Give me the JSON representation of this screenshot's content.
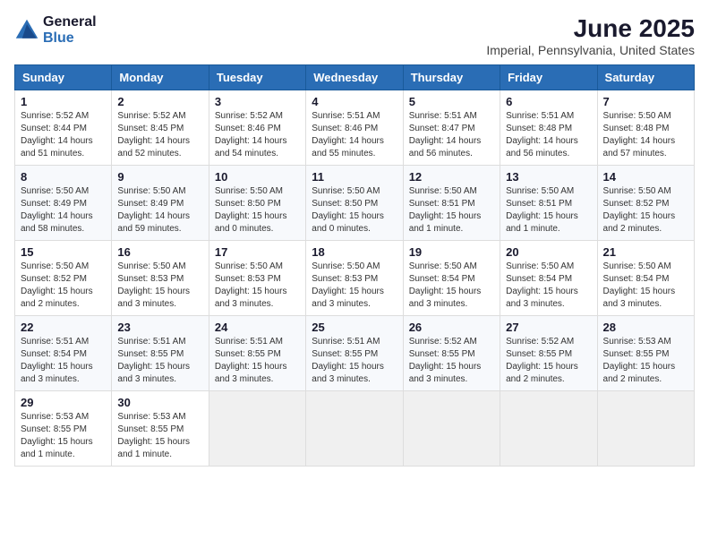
{
  "header": {
    "logo_general": "General",
    "logo_blue": "Blue",
    "main_title": "June 2025",
    "subtitle": "Imperial, Pennsylvania, United States"
  },
  "calendar": {
    "days_of_week": [
      "Sunday",
      "Monday",
      "Tuesday",
      "Wednesday",
      "Thursday",
      "Friday",
      "Saturday"
    ],
    "weeks": [
      [
        {
          "day": "1",
          "info": "Sunrise: 5:52 AM\nSunset: 8:44 PM\nDaylight: 14 hours\nand 51 minutes."
        },
        {
          "day": "2",
          "info": "Sunrise: 5:52 AM\nSunset: 8:45 PM\nDaylight: 14 hours\nand 52 minutes."
        },
        {
          "day": "3",
          "info": "Sunrise: 5:52 AM\nSunset: 8:46 PM\nDaylight: 14 hours\nand 54 minutes."
        },
        {
          "day": "4",
          "info": "Sunrise: 5:51 AM\nSunset: 8:46 PM\nDaylight: 14 hours\nand 55 minutes."
        },
        {
          "day": "5",
          "info": "Sunrise: 5:51 AM\nSunset: 8:47 PM\nDaylight: 14 hours\nand 56 minutes."
        },
        {
          "day": "6",
          "info": "Sunrise: 5:51 AM\nSunset: 8:48 PM\nDaylight: 14 hours\nand 56 minutes."
        },
        {
          "day": "7",
          "info": "Sunrise: 5:50 AM\nSunset: 8:48 PM\nDaylight: 14 hours\nand 57 minutes."
        }
      ],
      [
        {
          "day": "8",
          "info": "Sunrise: 5:50 AM\nSunset: 8:49 PM\nDaylight: 14 hours\nand 58 minutes."
        },
        {
          "day": "9",
          "info": "Sunrise: 5:50 AM\nSunset: 8:49 PM\nDaylight: 14 hours\nand 59 minutes."
        },
        {
          "day": "10",
          "info": "Sunrise: 5:50 AM\nSunset: 8:50 PM\nDaylight: 15 hours\nand 0 minutes."
        },
        {
          "day": "11",
          "info": "Sunrise: 5:50 AM\nSunset: 8:50 PM\nDaylight: 15 hours\nand 0 minutes."
        },
        {
          "day": "12",
          "info": "Sunrise: 5:50 AM\nSunset: 8:51 PM\nDaylight: 15 hours\nand 1 minute."
        },
        {
          "day": "13",
          "info": "Sunrise: 5:50 AM\nSunset: 8:51 PM\nDaylight: 15 hours\nand 1 minute."
        },
        {
          "day": "14",
          "info": "Sunrise: 5:50 AM\nSunset: 8:52 PM\nDaylight: 15 hours\nand 2 minutes."
        }
      ],
      [
        {
          "day": "15",
          "info": "Sunrise: 5:50 AM\nSunset: 8:52 PM\nDaylight: 15 hours\nand 2 minutes."
        },
        {
          "day": "16",
          "info": "Sunrise: 5:50 AM\nSunset: 8:53 PM\nDaylight: 15 hours\nand 3 minutes."
        },
        {
          "day": "17",
          "info": "Sunrise: 5:50 AM\nSunset: 8:53 PM\nDaylight: 15 hours\nand 3 minutes."
        },
        {
          "day": "18",
          "info": "Sunrise: 5:50 AM\nSunset: 8:53 PM\nDaylight: 15 hours\nand 3 minutes."
        },
        {
          "day": "19",
          "info": "Sunrise: 5:50 AM\nSunset: 8:54 PM\nDaylight: 15 hours\nand 3 minutes."
        },
        {
          "day": "20",
          "info": "Sunrise: 5:50 AM\nSunset: 8:54 PM\nDaylight: 15 hours\nand 3 minutes."
        },
        {
          "day": "21",
          "info": "Sunrise: 5:50 AM\nSunset: 8:54 PM\nDaylight: 15 hours\nand 3 minutes."
        }
      ],
      [
        {
          "day": "22",
          "info": "Sunrise: 5:51 AM\nSunset: 8:54 PM\nDaylight: 15 hours\nand 3 minutes."
        },
        {
          "day": "23",
          "info": "Sunrise: 5:51 AM\nSunset: 8:55 PM\nDaylight: 15 hours\nand 3 minutes."
        },
        {
          "day": "24",
          "info": "Sunrise: 5:51 AM\nSunset: 8:55 PM\nDaylight: 15 hours\nand 3 minutes."
        },
        {
          "day": "25",
          "info": "Sunrise: 5:51 AM\nSunset: 8:55 PM\nDaylight: 15 hours\nand 3 minutes."
        },
        {
          "day": "26",
          "info": "Sunrise: 5:52 AM\nSunset: 8:55 PM\nDaylight: 15 hours\nand 3 minutes."
        },
        {
          "day": "27",
          "info": "Sunrise: 5:52 AM\nSunset: 8:55 PM\nDaylight: 15 hours\nand 2 minutes."
        },
        {
          "day": "28",
          "info": "Sunrise: 5:53 AM\nSunset: 8:55 PM\nDaylight: 15 hours\nand 2 minutes."
        }
      ],
      [
        {
          "day": "29",
          "info": "Sunrise: 5:53 AM\nSunset: 8:55 PM\nDaylight: 15 hours\nand 1 minute."
        },
        {
          "day": "30",
          "info": "Sunrise: 5:53 AM\nSunset: 8:55 PM\nDaylight: 15 hours\nand 1 minute."
        },
        {
          "day": "",
          "info": ""
        },
        {
          "day": "",
          "info": ""
        },
        {
          "day": "",
          "info": ""
        },
        {
          "day": "",
          "info": ""
        },
        {
          "day": "",
          "info": ""
        }
      ]
    ]
  }
}
